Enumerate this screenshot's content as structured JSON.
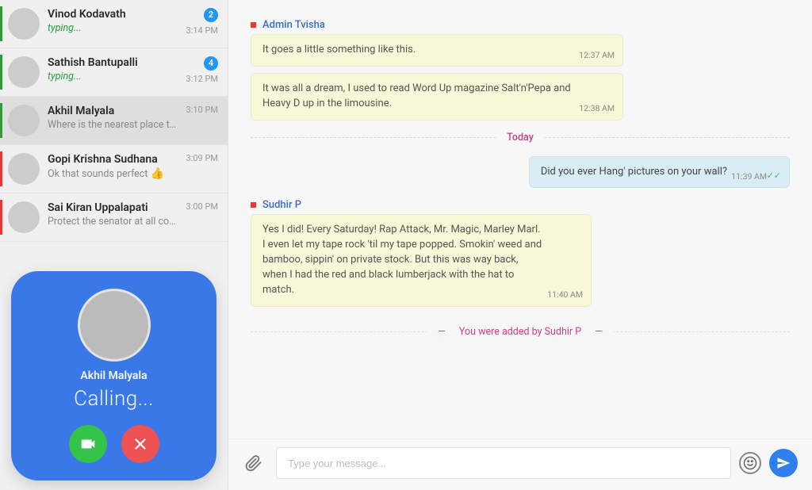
{
  "sidebar": {
    "contacts": [
      {
        "name": "Vinod Kodavath",
        "preview": "typing...",
        "typing": true,
        "time": "3:14 PM",
        "badge": "2",
        "stripe": "#2e9a3a"
      },
      {
        "name": "Sathish Bantupalli",
        "preview": "typing...",
        "typing": true,
        "time": "3:12 PM",
        "badge": "4",
        "stripe": "#2e9a3a"
      },
      {
        "name": "Akhil Malyala",
        "preview": "Where is the nearest place to...",
        "typing": false,
        "time": "3:10 PM",
        "stripe": "#2e9a3a",
        "selected": true
      },
      {
        "name": "Gopi Krishna Sudhana",
        "preview": "Ok that sounds perfect",
        "emoji": "👍",
        "typing": false,
        "time": "3:09 PM",
        "stripe": "#e53935"
      },
      {
        "name": "Sai Kiran Uppalapati",
        "preview": "Protect the senator at all costs.",
        "typing": false,
        "time": "3:00 PM",
        "stripe": "#e53935"
      }
    ]
  },
  "call": {
    "name": "Akhil Malyala",
    "status": "Calling..."
  },
  "chat": {
    "groups": [
      {
        "sender": "Admin Tvisha",
        "side": "incoming",
        "messages": [
          {
            "text": "It goes a little something like this.",
            "time": "12:37 AM"
          },
          {
            "text": "It was all a dream, I used to read Word Up magazine Salt'n'Pepa and Heavy D up in the limousine.",
            "time": "12:38 AM"
          }
        ]
      }
    ],
    "separator": "Today",
    "afterSeparator": [
      {
        "side": "outgoing",
        "messages": [
          {
            "text": "Did you ever Hang' pictures on your wall?",
            "time": "11:39 AM",
            "delivered": true
          }
        ]
      },
      {
        "sender": "Sudhir P",
        "side": "incoming",
        "messages": [
          {
            "text": "Yes I did! Every Saturday! Rap Attack, Mr. Magic, Marley Marl. I even let my tape rock 'til my tape popped. Smokin' weed and bamboo, sippin' on private stock.  But this was way back, when I had the red and black lumberjack with the hat to match.",
            "time": "11:40 AM"
          }
        ]
      }
    ],
    "systemMessage": "You were added by Sudhir P"
  },
  "composer": {
    "placeholder": "Type your message..."
  }
}
